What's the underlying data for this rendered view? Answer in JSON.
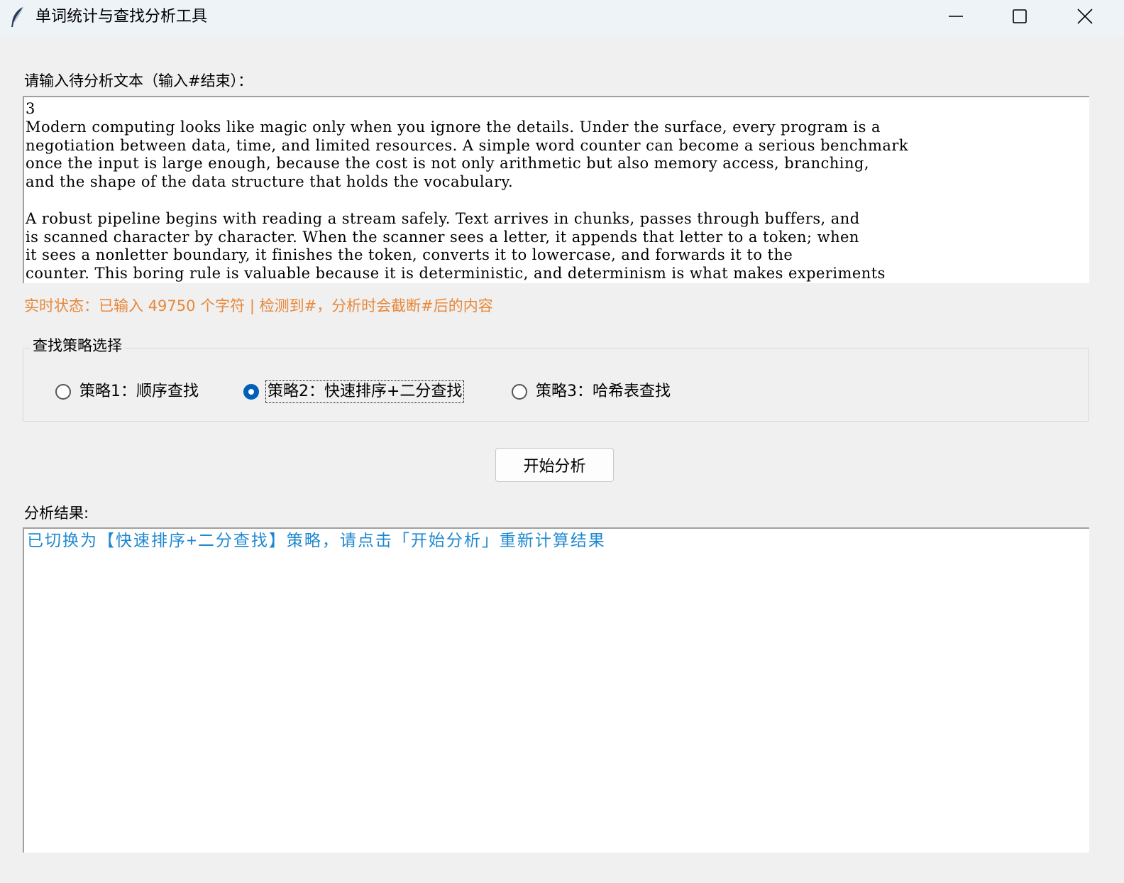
{
  "window": {
    "title": "单词统计与查找分析工具",
    "icon": "feather-icon",
    "controls": [
      "minimize-icon",
      "maximize-icon",
      "close-icon"
    ]
  },
  "input": {
    "label": "请输入待分析文本（输入#结束）：",
    "text": "3\nModern computing looks like magic only when you ignore the details. Under the surface, every program is a\nnegotiation between data, time, and limited resources. A simple word counter can become a serious benchmark\nonce the input is large enough, because the cost is not only arithmetic but also memory access, branching,\nand the shape of the data structure that holds the vocabulary.\n\nA robust pipeline begins with reading a stream safely. Text arrives in chunks, passes through buffers, and\nis scanned character by character. When the scanner sees a letter, it appends that letter to a token; when\nit sees a nonletter boundary, it finishes the token, converts it to lowercase, and forwards it to the\ncounter. This boring rule is valuable because it is deterministic, and determinism is what makes experiments"
  },
  "status": {
    "text": "实时状态：已输入 49750 个字符 | 检测到#，分析时会截断#后的内容",
    "color": "#e8883a"
  },
  "strategy_group": {
    "title": "查找策略选择",
    "options": [
      {
        "label": "策略1：顺序查找",
        "selected": false
      },
      {
        "label": "策略2：快速排序+二分查找",
        "selected": true
      },
      {
        "label": "策略3：哈希表查找",
        "selected": false
      }
    ],
    "accent_color": "#005fb8"
  },
  "actions": {
    "start_label": "开始分析"
  },
  "result": {
    "label": "分析结果:",
    "text": "已切换为【快速排序+二分查找】策略，请点击「开始分析」重新计算结果",
    "color": "#1e88d0"
  }
}
